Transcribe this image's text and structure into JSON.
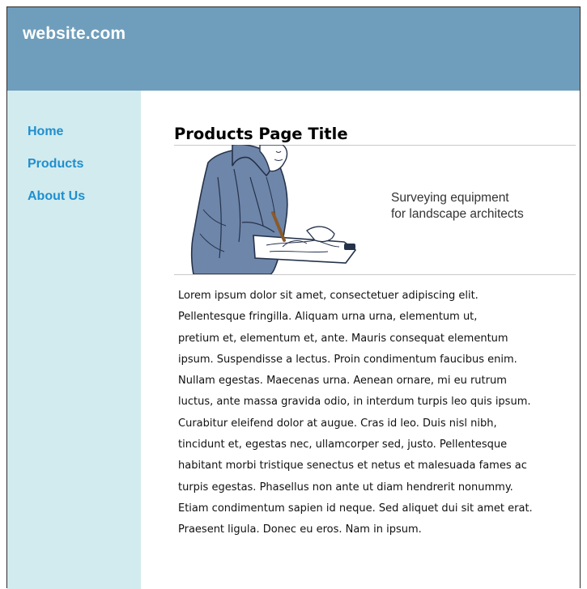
{
  "header": {
    "site_title": "website.com"
  },
  "sidebar": {
    "items": [
      {
        "label": "Home"
      },
      {
        "label": "Products"
      },
      {
        "label": "About Us"
      }
    ]
  },
  "main": {
    "title": "Products Page Title",
    "tagline_lines": [
      "Surveying equipment",
      "for landscape architects"
    ],
    "body_lines": [
      "Lorem ipsum dolor sit amet, consectetuer adipiscing elit.",
      "Pellentesque fringilla. Aliquam urna urna, elementum ut,",
      "pretium et, elementum et, ante. Mauris consequat elementum",
      "ipsum. Suspendisse a lectus. Proin condimentum faucibus enim.",
      "Nullam egestas. Maecenas urna. Aenean ornare, mi eu rutrum",
      "luctus, ante massa gravida odio, in interdum turpis leo quis ipsum.",
      "Curabitur eleifend dolor at augue. Cras id leo. Duis nisl nibh,",
      "tincidunt et, egestas nec, ullamcorper sed, justo. Pellentesque",
      "habitant morbi tristique senectus et netus et malesuada fames ac",
      "turpis egestas. Phasellus non ante ut diam hendrerit nonummy.",
      "Etiam condimentum sapien id neque. Sed aliquet dui sit amet erat.",
      "Praesent ligula. Donec eu eros. Nam in ipsum."
    ]
  },
  "colors": {
    "header_bg": "#6f9ebc",
    "sidebar_bg": "#d2ebee",
    "nav_link": "#1f8fcf"
  },
  "icons": {
    "illustration": "man-with-clipboard-illustration"
  }
}
